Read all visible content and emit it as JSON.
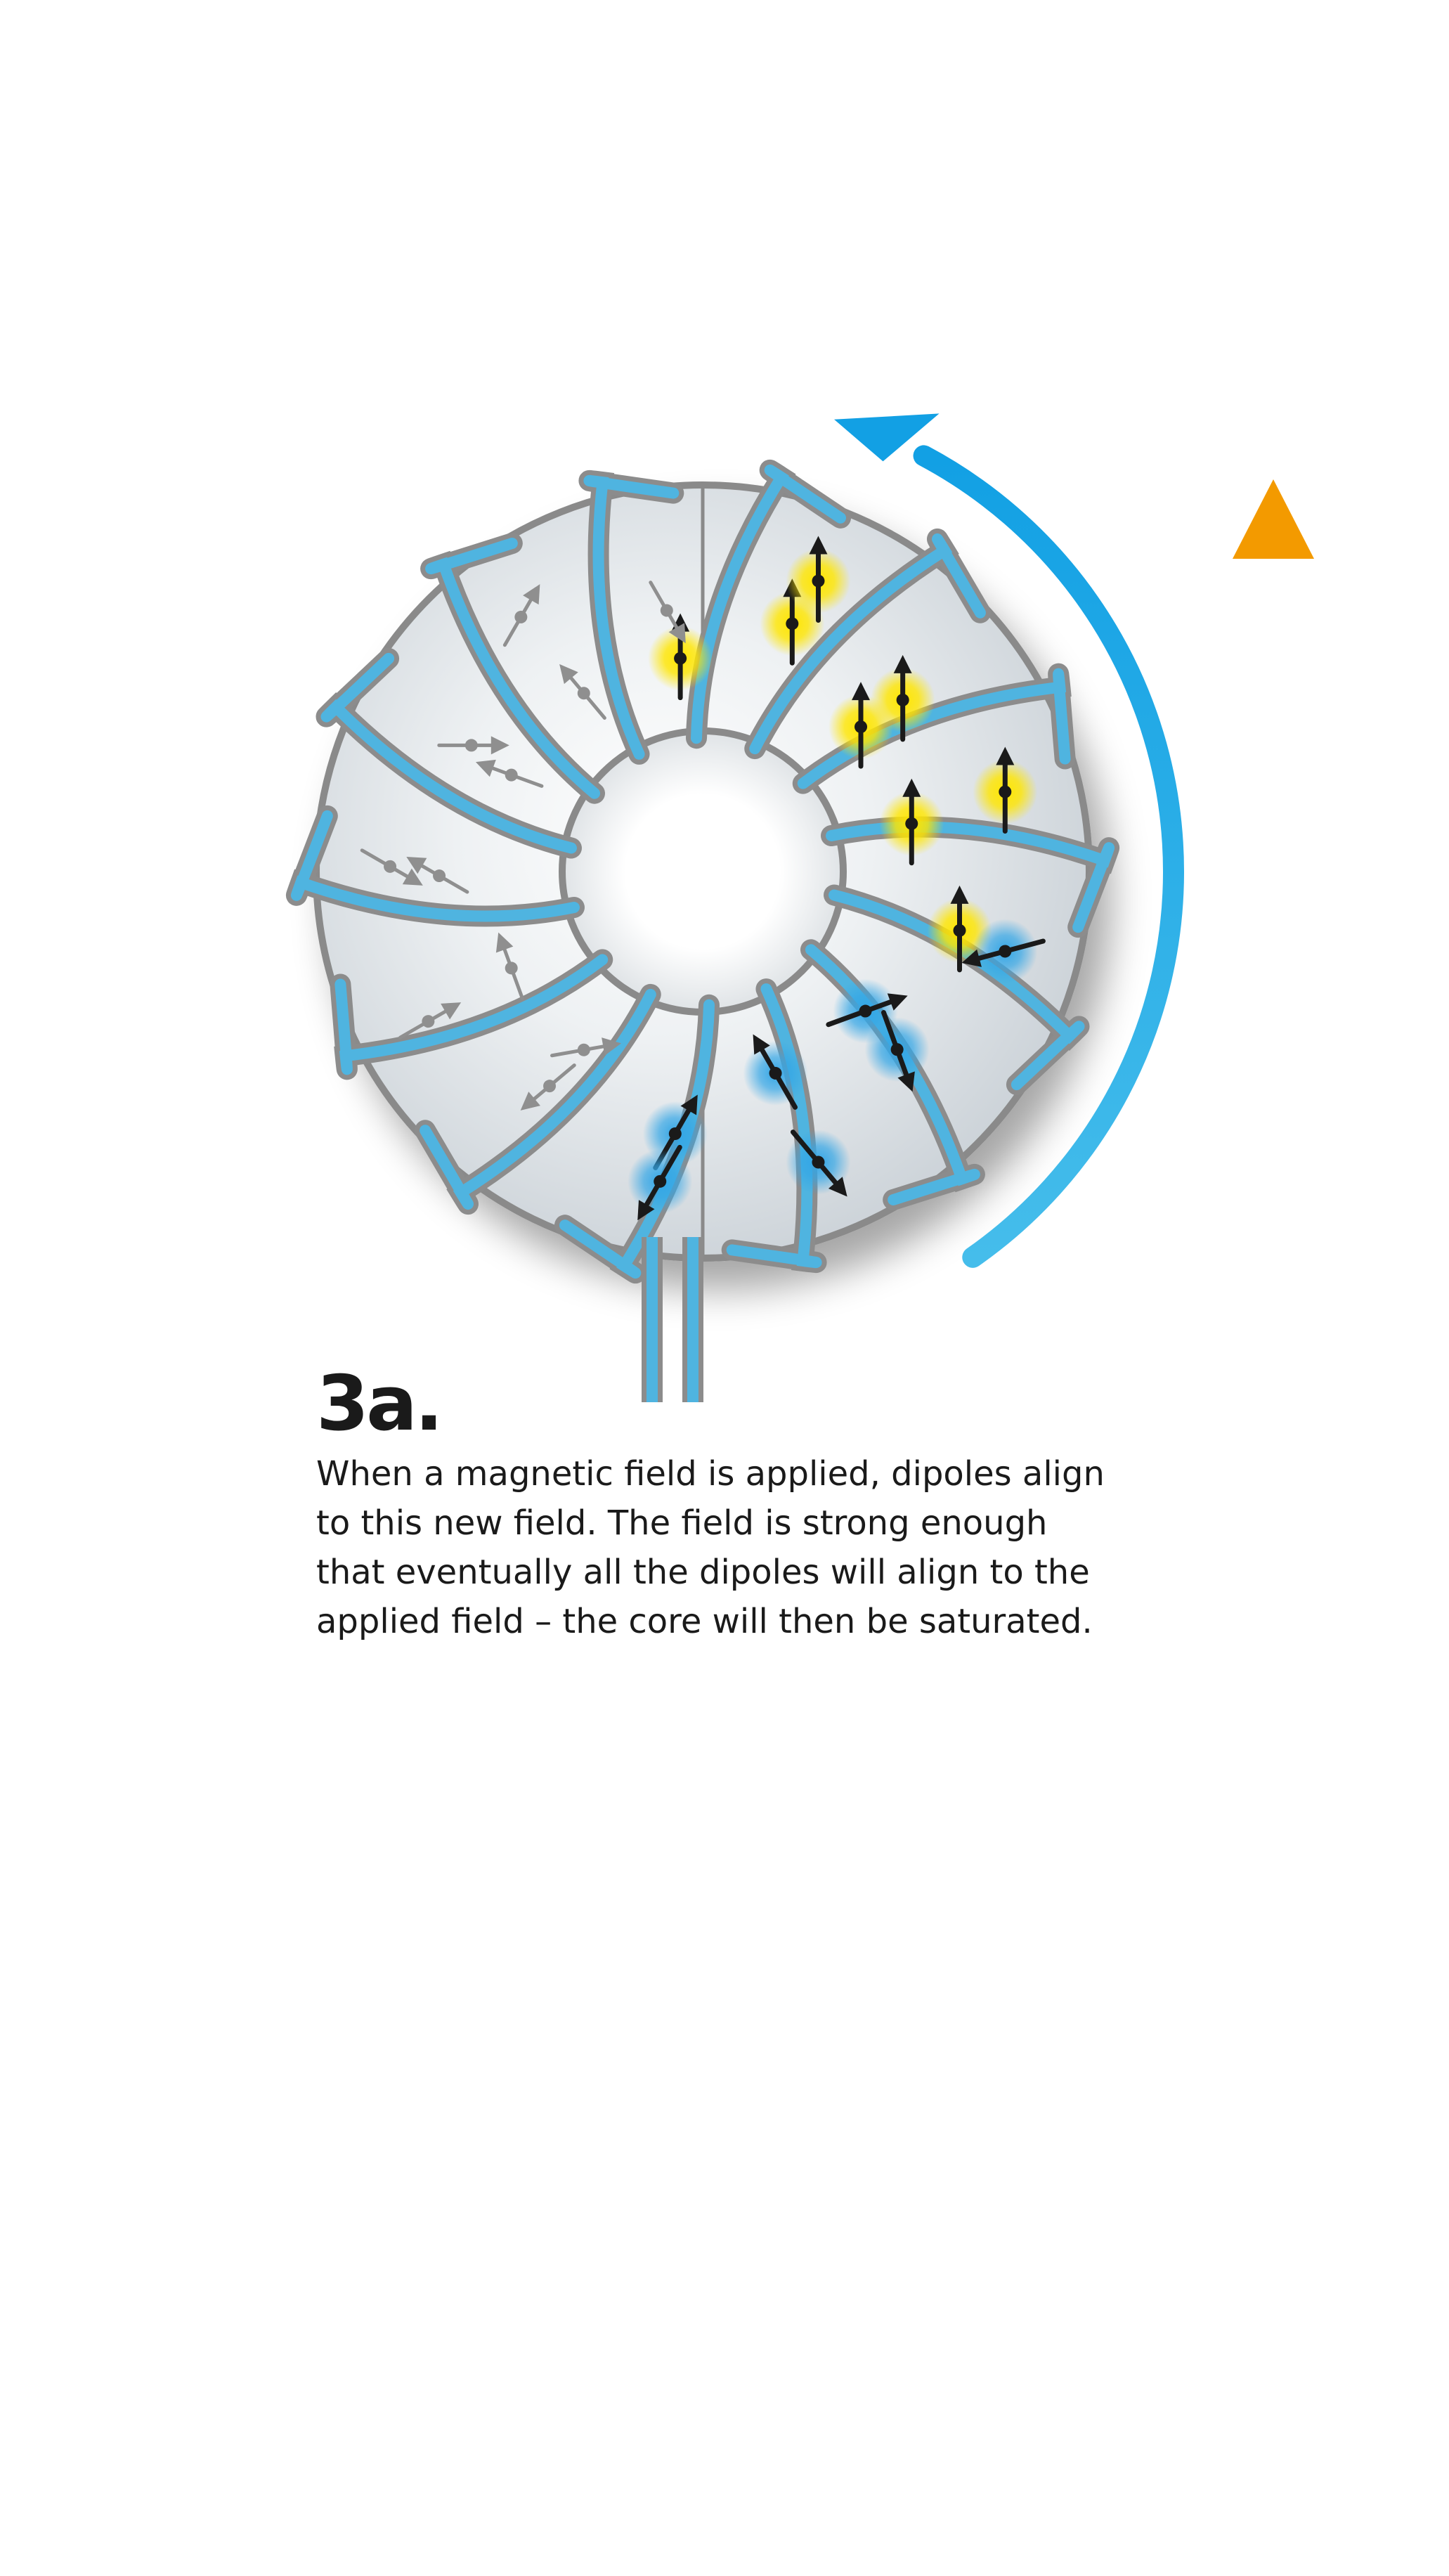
{
  "figure": {
    "step_label": "3a.",
    "description_lines": [
      "When a magnetic field is applied, dipoles align",
      "to this new field. The field is strong enough",
      "that eventually all the dipoles will align to the",
      "applied field – the core will then be saturated."
    ]
  },
  "colors": {
    "core_fill": "#e6e9ec",
    "core_outline": "#8a8a8a",
    "wire_blue": "#4fb4e0",
    "wire_outline": "#8c8c8c",
    "dipole_aligned": "#1a1a1a",
    "dipole_unaligned": "#8f8f8f",
    "glow_yellow": "#ffe600",
    "glow_blue": "#33a6e6",
    "circulating_arrow": "#1aa8e6",
    "field_arrow_top": "#f39a00",
    "field_arrow_bottom": "#ffd93a"
  },
  "dipoles": [
    {
      "state": "aligned",
      "glow": "yellow",
      "angle": 0
    },
    {
      "state": "aligned",
      "glow": "yellow",
      "angle": 0
    },
    {
      "state": "aligned",
      "glow": "yellow",
      "angle": 0
    },
    {
      "state": "aligned",
      "glow": "yellow",
      "angle": 0
    },
    {
      "state": "aligned",
      "glow": "yellow",
      "angle": 0
    },
    {
      "state": "aligned",
      "glow": "yellow",
      "angle": 0
    },
    {
      "state": "aligned",
      "glow": "yellow",
      "angle": 0
    },
    {
      "state": "aligned",
      "glow": "yellow",
      "angle": 0
    },
    {
      "state": "partial",
      "glow": "blue",
      "angle": -105
    },
    {
      "state": "partial",
      "glow": "blue",
      "angle": 70
    },
    {
      "state": "partial",
      "glow": "blue",
      "angle": 160
    },
    {
      "state": "partial",
      "glow": "blue",
      "angle": 140
    },
    {
      "state": "partial",
      "glow": "blue",
      "angle": -30
    },
    {
      "state": "partial",
      "glow": "blue",
      "angle": 30
    },
    {
      "state": "partial",
      "glow": "blue",
      "angle": -150
    },
    {
      "state": "unaligned",
      "glow": "none",
      "angle": 80
    },
    {
      "state": "unaligned",
      "glow": "none",
      "angle": -130
    },
    {
      "state": "unaligned",
      "glow": "none",
      "angle": 60
    },
    {
      "state": "unaligned",
      "glow": "none",
      "angle": -20
    },
    {
      "state": "unaligned",
      "glow": "none",
      "angle": -60
    },
    {
      "state": "unaligned",
      "glow": "none",
      "angle": 120
    },
    {
      "state": "unaligned",
      "glow": "none",
      "angle": -70
    },
    {
      "state": "unaligned",
      "glow": "none",
      "angle": 90
    },
    {
      "state": "unaligned",
      "glow": "none",
      "angle": 30
    },
    {
      "state": "unaligned",
      "glow": "none",
      "angle": -40
    },
    {
      "state": "unaligned",
      "glow": "none",
      "angle": 150
    }
  ]
}
